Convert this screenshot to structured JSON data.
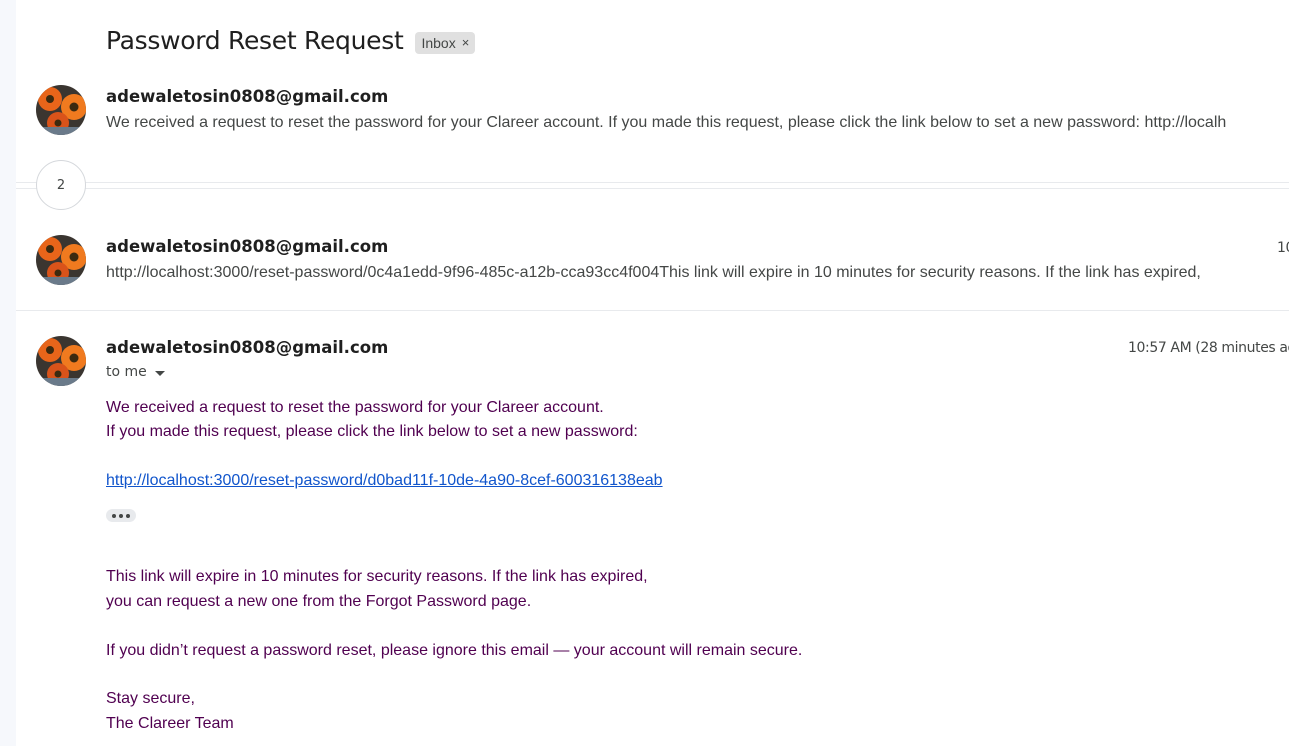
{
  "thread": {
    "subject": "Password Reset Request",
    "label": "Inbox",
    "label_remove": "×",
    "collapsed_count": "2"
  },
  "messages": [
    {
      "sender": "adewaletosin0808@gmail.com",
      "snippet": "We received a request to reset the password for your Clareer account. If you made this request, please click the link below to set a new password: http://localh"
    },
    {
      "sender": "adewaletosin0808@gmail.com",
      "snippet": "http://localhost:3000/reset-password/0c4a1edd-9f96-485c-a12b-cca93cc4f004This link will expire in 10 minutes for security reasons. If the link has expired,",
      "time": "10"
    },
    {
      "sender": "adewaletosin0808@gmail.com",
      "time": "10:57 AM (28 minutes ag",
      "recipient": "to me",
      "body": {
        "line1": "We received a request to reset the password for your Clareer account.",
        "line2": "If you made this request, please click the link below to set a new password:",
        "link": "http://localhost:3000/reset-password/d0bad11f-10de-4a90-8cef-600316138eab",
        "line3": "This link will expire in 10 minutes for security reasons. If the link has expired,",
        "line4": "you can request a new one from the Forgot Password page.",
        "line5": "If you didn’t request a password reset, please ignore this email — your account will remain secure.",
        "line6": "Stay secure,",
        "line7": "The Clareer Team"
      }
    }
  ],
  "icons": {
    "avatar": "sender-avatar",
    "caret": "caret-down-icon",
    "trim": "show-trimmed-content-icon"
  },
  "colors": {
    "body_text": "#500050",
    "link": "#1155cc",
    "sender_text": "#1f1f1f",
    "meta_text": "#444746"
  }
}
